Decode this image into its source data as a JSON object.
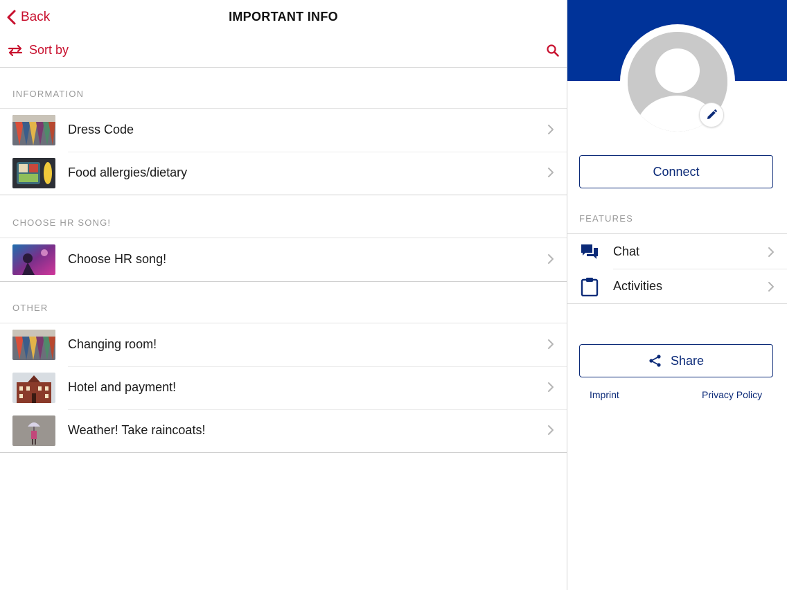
{
  "header": {
    "back_label": "Back",
    "title": "IMPORTANT INFO",
    "sort_label": "Sort by"
  },
  "sections": [
    {
      "heading": "INFORMATION",
      "items": [
        {
          "label": "Dress Code",
          "thumb": "clothes-rack-thumbnail"
        },
        {
          "label": "Food allergies/dietary",
          "thumb": "lunchbox-thumbnail"
        }
      ]
    },
    {
      "heading": "CHOOSE HR SONG!",
      "items": [
        {
          "label": "Choose HR song!",
          "thumb": "concert-thumbnail"
        }
      ]
    },
    {
      "heading": "OTHER",
      "items": [
        {
          "label": "Changing room!",
          "thumb": "clothes-rack-thumbnail"
        },
        {
          "label": "Hotel and payment!",
          "thumb": "hotel-building-thumbnail"
        },
        {
          "label": "Weather! Take raincoats!",
          "thumb": "umbrella-rain-thumbnail"
        }
      ]
    }
  ],
  "profile": {
    "connect_label": "Connect",
    "features_heading": "FEATURES",
    "features": [
      {
        "label": "Chat",
        "icon": "chat-icon"
      },
      {
        "label": "Activities",
        "icon": "clipboard-icon"
      }
    ],
    "share_label": "Share",
    "imprint_label": "Imprint",
    "privacy_label": "Privacy Policy"
  },
  "colors": {
    "accent_red": "#c8102e",
    "brand_blue": "#003399",
    "button_navy": "#0b2a78"
  }
}
